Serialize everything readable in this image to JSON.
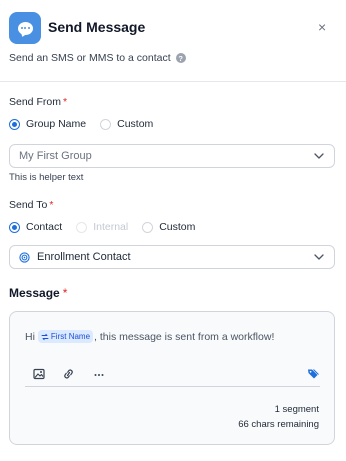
{
  "header": {
    "title": "Send Message",
    "subtitle": "Send an SMS or MMS to a contact",
    "close_label": "×",
    "help_glyph": "?"
  },
  "send_from": {
    "label": "Send From",
    "required_mark": "*",
    "options": [
      "Group Name",
      "Custom"
    ],
    "selected": "Group Name",
    "select_value": "My First Group",
    "helper_text": "This is helper text"
  },
  "send_to": {
    "label": "Send To",
    "required_mark": "*",
    "options": [
      "Contact",
      "Internal",
      "Custom"
    ],
    "selected": "Contact",
    "disabled": [
      "Internal"
    ],
    "select_value": "Enrollment Contact"
  },
  "message": {
    "label": "Message",
    "required_mark": "*",
    "text_before": "Hi",
    "merge_field": "First Name",
    "text_after": ", this message is sent from a workflow!",
    "segments": "1 segment",
    "chars_remaining": "66 chars remaining",
    "toolbar_icons": [
      "image-icon",
      "link-icon",
      "more-icon",
      "tag-icon"
    ]
  },
  "colors": {
    "accent": "#1d6fdc",
    "header_icon_bg": "#4a90e2",
    "required": "#dc2626"
  }
}
